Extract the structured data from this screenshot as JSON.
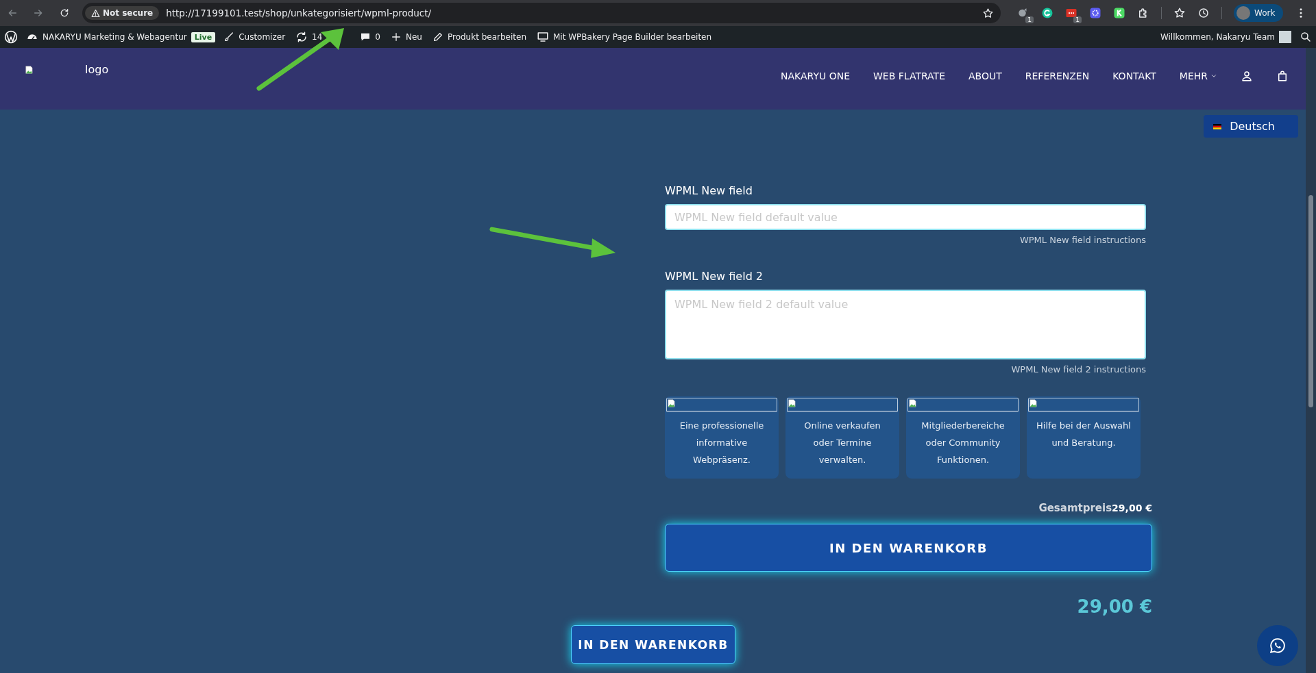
{
  "browser": {
    "security": "Not secure",
    "url": "http://17199101.test/shop/unkategorisiert/wpml-product/",
    "extensions": [
      {
        "kind": "badge-icon",
        "badge": "1"
      },
      {
        "kind": "g"
      },
      {
        "kind": "badge-red",
        "badge": "1"
      },
      {
        "kind": "star"
      },
      {
        "kind": "k"
      },
      {
        "kind": "puzzle"
      }
    ],
    "profile": "Work"
  },
  "admin_bar": {
    "site": "NAKARYU Marketing & Webagentur",
    "live": "Live",
    "items": [
      {
        "kind": "brush",
        "label": "Customizer"
      },
      {
        "kind": "updates",
        "label": "14"
      },
      {
        "kind": "comments",
        "label": "0"
      },
      {
        "kind": "plus",
        "label": "Neu"
      },
      {
        "kind": "pencil",
        "label": "Produkt bearbeiten"
      },
      {
        "kind": "screen",
        "label": "Mit WPBakery Page Builder bearbeiten"
      }
    ],
    "greeting": "Willkommen, Nakaryu Team"
  },
  "header": {
    "logo": "logo",
    "nav": [
      {
        "label": "NAKARYU ONE",
        "dropdown": false
      },
      {
        "label": "WEB FLATRATE",
        "dropdown": false
      },
      {
        "label": "ABOUT",
        "dropdown": false
      },
      {
        "label": "REFERENZEN",
        "dropdown": false
      },
      {
        "label": "KONTAKT",
        "dropdown": false
      },
      {
        "label": "MEHR",
        "dropdown": true
      }
    ]
  },
  "language": "Deutsch",
  "fields": [
    {
      "kind": "input",
      "label": "WPML New field",
      "placeholder": "WPML New field default value",
      "instructions": "WPML New field instructions"
    },
    {
      "kind": "textarea",
      "label": "WPML New field 2",
      "placeholder": "WPML New field 2 default value",
      "instructions": "WPML New field 2 instructions"
    }
  ],
  "cards": [
    "Eine professionelle informative Webpräsenz.",
    "Online verkaufen oder Termine verwalten.",
    "Mitgliederbereiche oder Community Funktionen.",
    "Hilfe bei der Auswahl und Beratung."
  ],
  "total": {
    "label": "Gesamtpreis",
    "value": "29,00 €"
  },
  "add_to_cart": "IN DEN WARENKORB",
  "price": "29,00 €",
  "sticky_add_to_cart": "IN DEN WARENKORB"
}
